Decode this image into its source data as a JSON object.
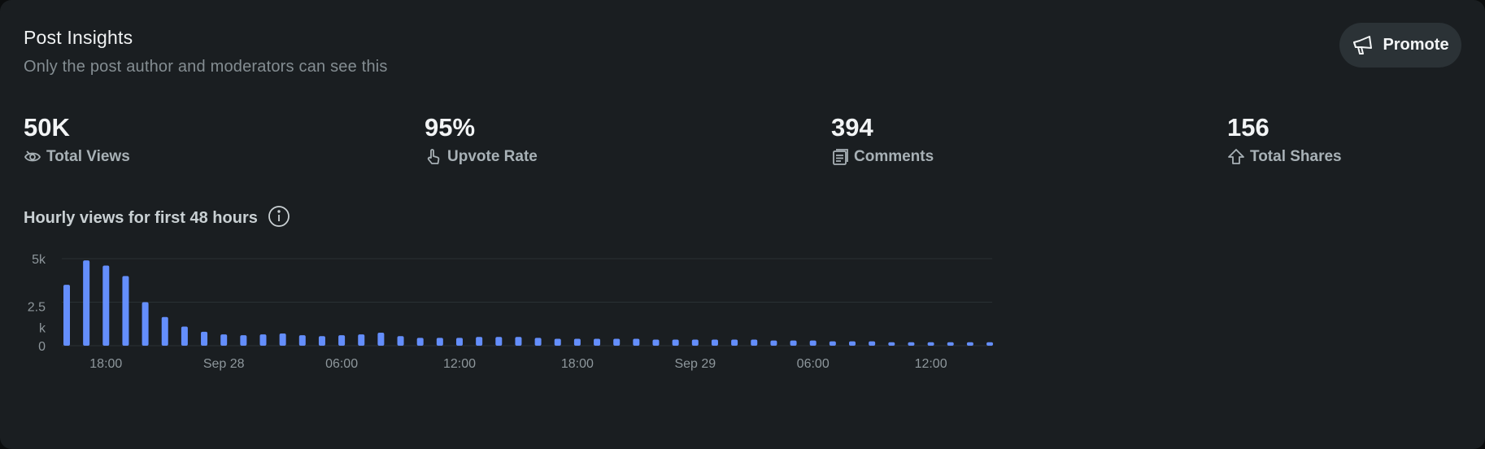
{
  "header": {
    "title": "Post Insights",
    "subtitle": "Only the post author and moderators can see this",
    "promote_label": "Promote"
  },
  "stats": [
    {
      "value": "50K",
      "label": "Total Views",
      "icon": "views-icon"
    },
    {
      "value": "95%",
      "label": "Upvote Rate",
      "icon": "hand-pointer-icon"
    },
    {
      "value": "394",
      "label": "Comments",
      "icon": "comments-icon"
    },
    {
      "value": "156",
      "label": "Total Shares",
      "icon": "share-icon"
    }
  ],
  "colors": {
    "background": "#1a1e21",
    "bar": "#648efc",
    "text_primary": "#f2f4f5",
    "text_secondary": "#848d92"
  },
  "chart_data": {
    "type": "bar",
    "title": "Hourly views for first 48 hours",
    "info_icon": "info-icon",
    "ylim": [
      0,
      5000
    ],
    "y_ticks": [
      {
        "value": 0,
        "label": "0"
      },
      {
        "value": 2500,
        "label": "2.5 k"
      },
      {
        "value": 5000,
        "label": "5k"
      }
    ],
    "x_tick_labels": [
      {
        "index": 2,
        "label": "18:00"
      },
      {
        "index": 8,
        "label": "Sep 28"
      },
      {
        "index": 14,
        "label": "06:00"
      },
      {
        "index": 20,
        "label": "12:00"
      },
      {
        "index": 26,
        "label": "18:00"
      },
      {
        "index": 32,
        "label": "Sep 29"
      },
      {
        "index": 38,
        "label": "06:00"
      },
      {
        "index": 44,
        "label": "12:00"
      }
    ],
    "values": [
      3500,
      4900,
      4600,
      4000,
      2500,
      1650,
      1100,
      800,
      650,
      600,
      650,
      700,
      600,
      550,
      600,
      650,
      750,
      550,
      450,
      450,
      450,
      500,
      500,
      500,
      450,
      400,
      400,
      400,
      400,
      400,
      350,
      350,
      350,
      350,
      350,
      350,
      300,
      300,
      300,
      250,
      250,
      250,
      200,
      200,
      200,
      200,
      200,
      200
    ]
  }
}
